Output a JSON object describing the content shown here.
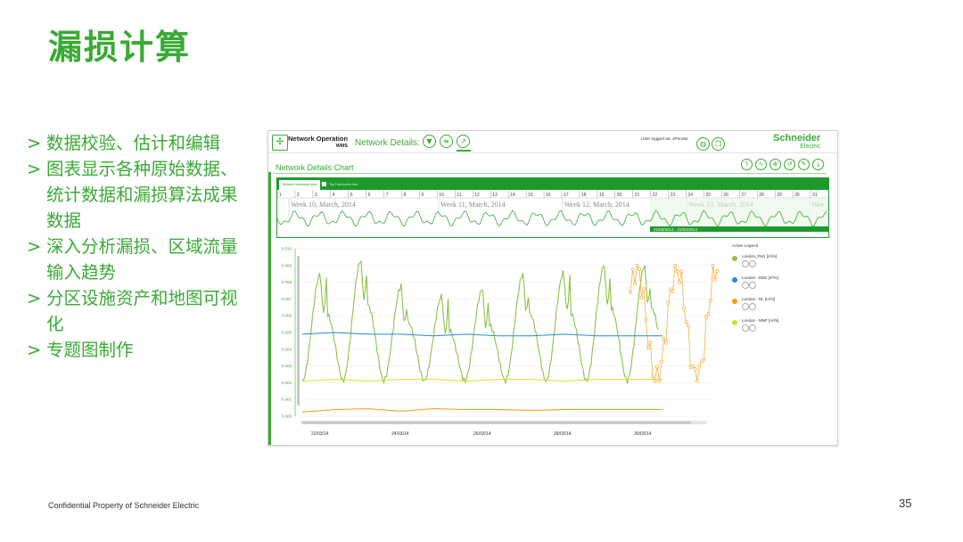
{
  "slide": {
    "title": "漏损计算",
    "bullets": [
      {
        "mark": ">",
        "text": "数据校验、估计和编辑"
      },
      {
        "mark": ">",
        "text": "图表显示各种原始数据、统计数据和漏损算法成果数据"
      },
      {
        "mark": ">",
        "text": "深入分析漏损、区域流量输入趋势"
      },
      {
        "mark": ">",
        "text": "分区设施资产和地图可视化"
      },
      {
        "mark": ">",
        "text": "专题图制作"
      }
    ],
    "footer": "Confidential Property of Schneider Electric",
    "page_number": "35"
  },
  "app": {
    "name_line1": "Network Operation",
    "name_line2": "WMS",
    "network_details_label": "Network Details:",
    "toolbar_icons": [
      "filter-icon",
      "list-icon",
      "chart-icon"
    ],
    "user_text": "User logged as: JPenate",
    "user_icons": [
      "globe-icon",
      "copy-icon"
    ],
    "brand_line1": "Schneider",
    "brand_line2": "Electric",
    "chart_title": "Network Details Chart",
    "chart_tool_icons": [
      "export-icon",
      "line-icon",
      "zoom-icon",
      "reset-icon",
      "draw-icon",
      "pdf-icon"
    ],
    "accent_color": "#3aaa35",
    "overview": {
      "tab_active": "Bottom Horizontal Axis",
      "tab_inactive": "Top Horizontal Axis",
      "day_ticks": [
        "1",
        "2",
        "3",
        "4",
        "5",
        "6",
        "7",
        "8",
        "9",
        "10",
        "11",
        "12",
        "13",
        "14",
        "15",
        "16",
        "17",
        "18",
        "19",
        "20",
        "21",
        "22",
        "23",
        "24",
        "25",
        "26",
        "27",
        "28",
        "29",
        "30",
        "31"
      ],
      "week_labels": [
        "Week 10, March, 2014",
        "Week 11, March, 2014",
        "Week 12, March, 2014",
        "Week 13, March, 2014",
        "Wee"
      ],
      "range_label": "21/03/2014 - 31/03/2014"
    }
  },
  "chart_data": {
    "type": "line",
    "y_ticks": [
      "0.010",
      "0.009",
      "0.008",
      "0.007",
      "0.006",
      "0.005",
      "0.004",
      "0.003",
      "0.002",
      "0.001",
      "0.000"
    ],
    "ylim": [
      0,
      0.01
    ],
    "x_tick_labels": [
      "22/03/14",
      "24/03/14",
      "26/03/14",
      "28/03/14",
      "30/03/14"
    ],
    "legend_title": "Active Legend",
    "series": [
      {
        "name": "London_FM1 [m³/s]",
        "color": "#8cc63f",
        "note_values": "daily cycles, peaks ~0.0085-0.0093, troughs ~0.0020"
      },
      {
        "name": "London - DEE [m³/s]",
        "color": "#1f8fd4",
        "values": [
          0.0049,
          0.005,
          0.0049,
          0.0049,
          0.0048,
          0.0049,
          0.0048,
          0.0048,
          0.0049,
          0.0048,
          0.0048,
          0.0048
        ]
      },
      {
        "name": "London - DL [m³/s]",
        "color": "#f39c12",
        "values": [
          0.00025,
          0.0004,
          0.00045,
          0.0003,
          0.00045,
          0.0004,
          0.0004,
          0.00035,
          0.0004,
          0.0004,
          0.0004,
          0.0004
        ]
      },
      {
        "name": "London - MNF [m³/s]",
        "color": "#d9df2a",
        "values": [
          0.0021,
          0.0022,
          0.0021,
          0.0022,
          0.0022,
          0.0021,
          0.0022,
          0.0022,
          0.0021,
          0.0022,
          0.0022,
          0.0022
        ]
      }
    ]
  }
}
